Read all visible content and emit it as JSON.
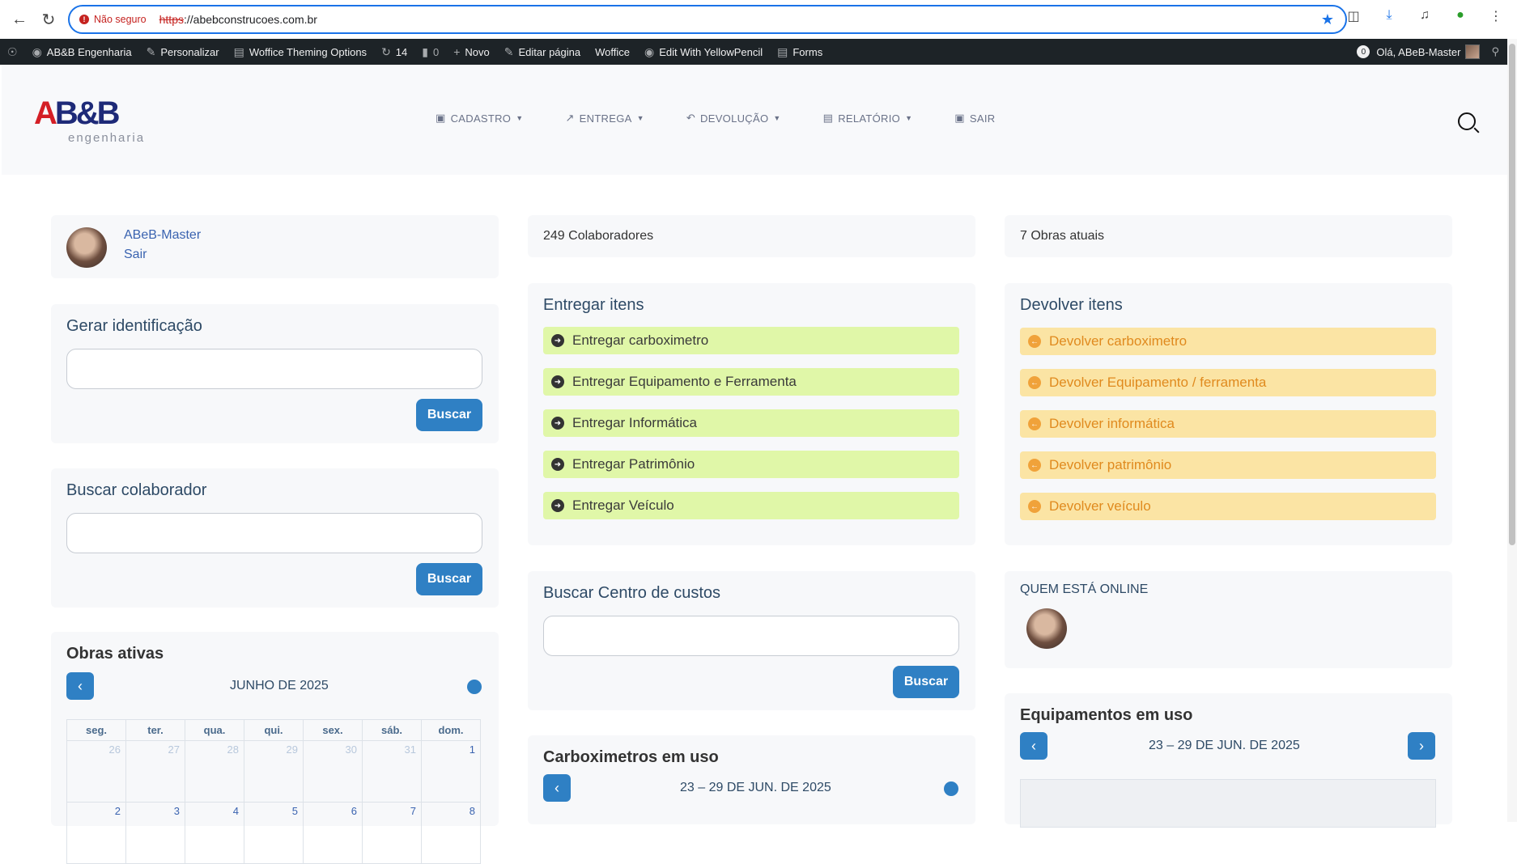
{
  "browser": {
    "security_label": "Não seguro",
    "url_scheme": "https",
    "url_rest": "://abebconstrucoes.com.br"
  },
  "admin_bar": {
    "site_name": "AB&B Engenharia",
    "customize": "Personalizar",
    "theme_options": "Woffice Theming Options",
    "updates_count": "14",
    "comments_count": "0",
    "new": "Novo",
    "edit_page": "Editar página",
    "woffice": "Woffice",
    "yellowpencil": "Edit With YellowPencil",
    "forms": "Forms",
    "notif_count": "0",
    "greeting": "Olá, ABeB-Master"
  },
  "logo": {
    "mark_a": "A",
    "mark_b": "B&B",
    "sub": "engenharia"
  },
  "nav": [
    "CADASTRO",
    "ENTREGA",
    "DEVOLUÇÃO",
    "RELATÓRIO",
    "SAIR"
  ],
  "profile": {
    "name": "ABeB-Master",
    "logout": "Sair"
  },
  "stats": {
    "collaborators": "249 Colaboradores",
    "works": "7 Obras atuais"
  },
  "gerar": {
    "title": "Gerar identificação",
    "button": "Buscar"
  },
  "buscar_colab": {
    "title": "Buscar colaborador",
    "button": "Buscar"
  },
  "entregar": {
    "title": "Entregar itens",
    "items": [
      "Entregar carboximetro",
      "Entregar Equipamento e Ferramenta",
      "Entregar Informática",
      "Entregar Patrimônio",
      "Entregar Veículo"
    ]
  },
  "devolver": {
    "title": "Devolver itens",
    "items": [
      "Devolver carboximetro",
      "Devolver Equipamento / ferramenta",
      "Devolver informática",
      "Devolver patrimônio",
      "Devolver veículo"
    ]
  },
  "centro": {
    "title": "Buscar Centro de custos",
    "button": "Buscar"
  },
  "online": {
    "title": "QUEM ESTÁ ONLINE"
  },
  "obras": {
    "title": "Obras ativas",
    "month": "JUNHO DE 2025",
    "weekdays": [
      "seg.",
      "ter.",
      "qua.",
      "qui.",
      "sex.",
      "sáb.",
      "dom."
    ],
    "week1": [
      "26",
      "27",
      "28",
      "29",
      "30",
      "31",
      "1"
    ],
    "week2": [
      "2",
      "3",
      "4",
      "5",
      "6",
      "7",
      "8"
    ]
  },
  "carbox": {
    "title": "Carboximetros em uso",
    "range": "23 – 29 DE JUN. DE 2025"
  },
  "equip": {
    "title": "Equipamentos em uso",
    "range": "23 – 29 DE JUN. DE 2025"
  }
}
